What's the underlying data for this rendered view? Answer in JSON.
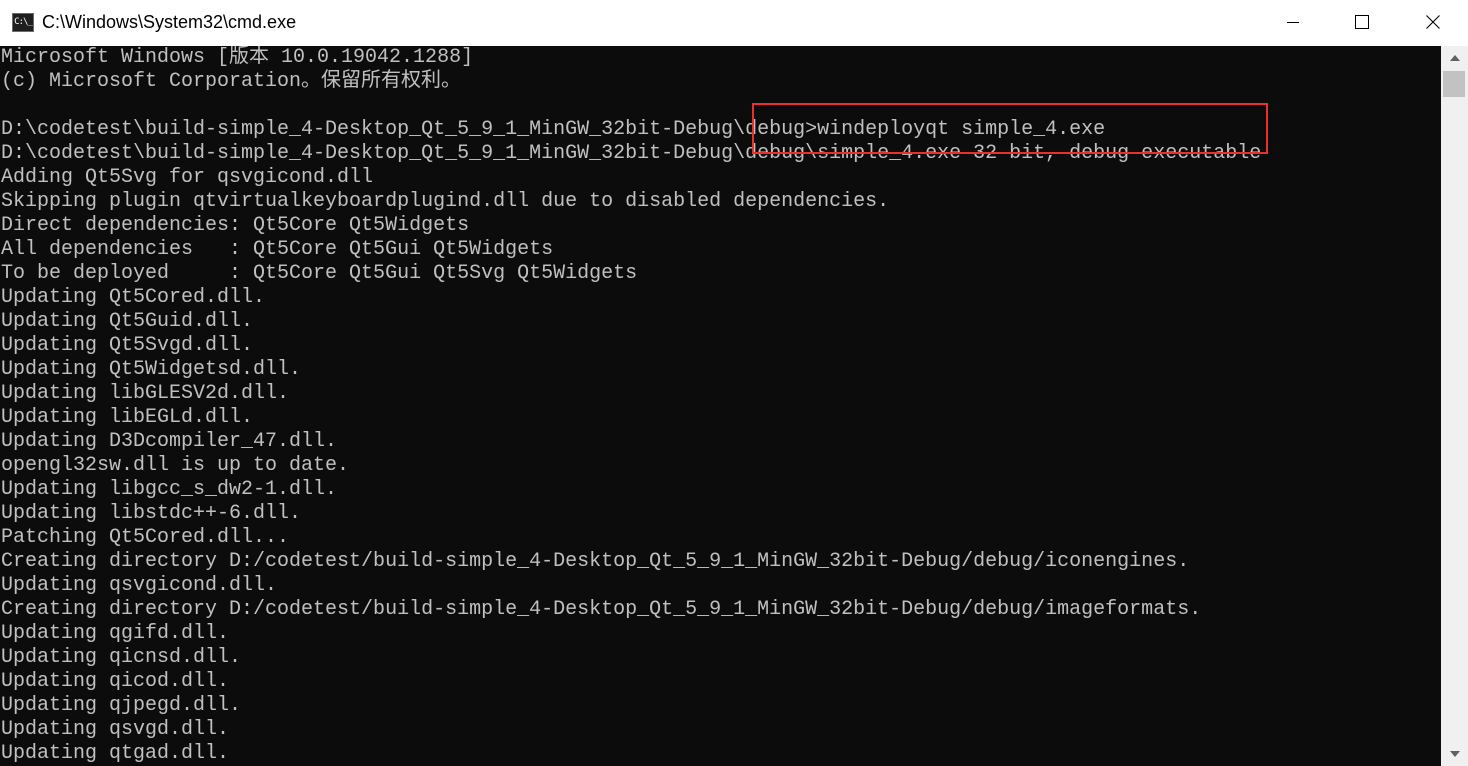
{
  "window": {
    "title": "C:\\Windows\\System32\\cmd.exe",
    "icon_text": "C:\\_"
  },
  "controls": {
    "minimize_icon": "minimize-icon",
    "maximize_icon": "maximize-icon",
    "close_icon": "close-icon"
  },
  "console": {
    "lines": [
      "Microsoft Windows [版本 10.0.19042.1288]",
      "(c) Microsoft Corporation。保留所有权利。",
      "",
      "D:\\codetest\\build-simple_4-Desktop_Qt_5_9_1_MinGW_32bit-Debug\\debug>windeployqt simple_4.exe",
      "D:\\codetest\\build-simple_4-Desktop_Qt_5_9_1_MinGW_32bit-Debug\\debug\\simple_4.exe 32 bit, debug executable",
      "Adding Qt5Svg for qsvgicond.dll",
      "Skipping plugin qtvirtualkeyboardplugind.dll due to disabled dependencies.",
      "Direct dependencies: Qt5Core Qt5Widgets",
      "All dependencies   : Qt5Core Qt5Gui Qt5Widgets",
      "To be deployed     : Qt5Core Qt5Gui Qt5Svg Qt5Widgets",
      "Updating Qt5Cored.dll.",
      "Updating Qt5Guid.dll.",
      "Updating Qt5Svgd.dll.",
      "Updating Qt5Widgetsd.dll.",
      "Updating libGLESV2d.dll.",
      "Updating libEGLd.dll.",
      "Updating D3Dcompiler_47.dll.",
      "opengl32sw.dll is up to date.",
      "Updating libgcc_s_dw2-1.dll.",
      "Updating libstdc++-6.dll.",
      "Patching Qt5Cored.dll...",
      "Creating directory D:/codetest/build-simple_4-Desktop_Qt_5_9_1_MinGW_32bit-Debug/debug/iconengines.",
      "Updating qsvgicond.dll.",
      "Creating directory D:/codetest/build-simple_4-Desktop_Qt_5_9_1_MinGW_32bit-Debug/debug/imageformats.",
      "Updating qgifd.dll.",
      "Updating qicnsd.dll.",
      "Updating qicod.dll.",
      "Updating qjpegd.dll.",
      "Updating qsvgd.dll.",
      "Updating qtgad.dll."
    ]
  },
  "colors": {
    "console_bg": "#0c0c0c",
    "console_text": "#c0c0c0",
    "highlight": "#e8312c"
  }
}
